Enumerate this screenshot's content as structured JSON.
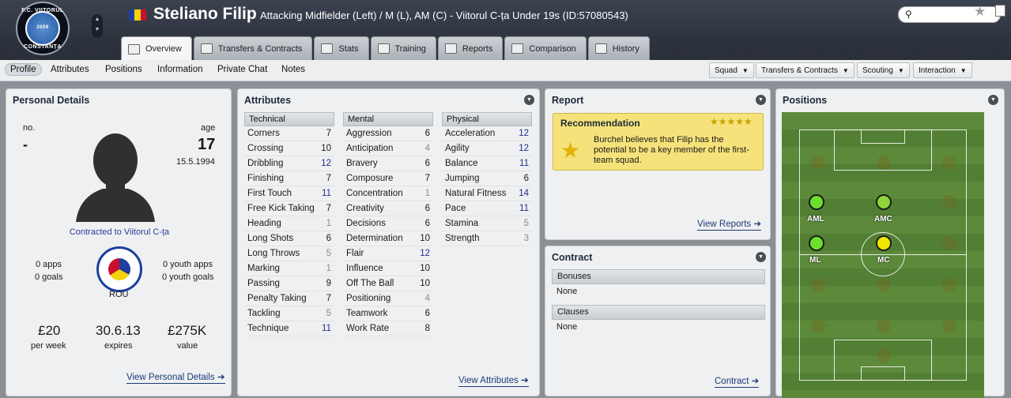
{
  "header": {
    "player_name": "Steliano Filip",
    "description": "Attacking Midfielder (Left) / M (L), AM (C) - Viitorul C-ța Under 19s (ID:57080543)",
    "club_badge_top": "F.C. VIITORUL",
    "club_badge_bottom": "CONSTANȚA",
    "club_badge_year": "2009"
  },
  "tabs": [
    {
      "label": "Overview"
    },
    {
      "label": "Transfers & Contracts"
    },
    {
      "label": "Stats"
    },
    {
      "label": "Training"
    },
    {
      "label": "Reports"
    },
    {
      "label": "Comparison"
    },
    {
      "label": "History"
    }
  ],
  "subnav": {
    "links": [
      "Profile",
      "Attributes",
      "Positions",
      "Information",
      "Private Chat",
      "Notes"
    ],
    "dropdowns": [
      "Squad",
      "Transfers & Contracts",
      "Scouting",
      "Interaction"
    ]
  },
  "personal": {
    "title": "Personal Details",
    "no_label": "no.",
    "no_value": "-",
    "age_label": "age",
    "age_value": "17",
    "dob": "15.5.1994",
    "contract": "Contracted to Viitorul C-ța",
    "apps": "0 apps",
    "goals": "0 goals",
    "youth_apps": "0 youth apps",
    "youth_goals": "0 youth goals",
    "nation": "ROU",
    "wage": "£20",
    "wage_label": "per week",
    "expires": "30.6.13",
    "expires_label": "expires",
    "value": "£275K",
    "value_label": "value",
    "link": "View Personal Details"
  },
  "attributes": {
    "title": "Attributes",
    "link": "View Attributes",
    "technical": {
      "label": "Technical",
      "rows": [
        [
          "Corners",
          "7"
        ],
        [
          "Crossing",
          "10"
        ],
        [
          "Dribbling",
          "12"
        ],
        [
          "Finishing",
          "7"
        ],
        [
          "First Touch",
          "11"
        ],
        [
          "Free Kick Taking",
          "7"
        ],
        [
          "Heading",
          "1"
        ],
        [
          "Long Shots",
          "6"
        ],
        [
          "Long Throws",
          "5"
        ],
        [
          "Marking",
          "1"
        ],
        [
          "Passing",
          "9"
        ],
        [
          "Penalty Taking",
          "7"
        ],
        [
          "Tackling",
          "5"
        ],
        [
          "Technique",
          "11"
        ]
      ]
    },
    "mental": {
      "label": "Mental",
      "rows": [
        [
          "Aggression",
          "6"
        ],
        [
          "Anticipation",
          "4"
        ],
        [
          "Bravery",
          "6"
        ],
        [
          "Composure",
          "7"
        ],
        [
          "Concentration",
          "1"
        ],
        [
          "Creativity",
          "6"
        ],
        [
          "Decisions",
          "6"
        ],
        [
          "Determination",
          "10"
        ],
        [
          "Flair",
          "12"
        ],
        [
          "Influence",
          "10"
        ],
        [
          "Off The Ball",
          "10"
        ],
        [
          "Positioning",
          "4"
        ],
        [
          "Teamwork",
          "6"
        ],
        [
          "Work Rate",
          "8"
        ]
      ]
    },
    "physical": {
      "label": "Physical",
      "rows": [
        [
          "Acceleration",
          "12"
        ],
        [
          "Agility",
          "12"
        ],
        [
          "Balance",
          "11"
        ],
        [
          "Jumping",
          "6"
        ],
        [
          "Natural Fitness",
          "14"
        ],
        [
          "Pace",
          "11"
        ],
        [
          "Stamina",
          "5"
        ],
        [
          "Strength",
          "3"
        ]
      ]
    }
  },
  "report": {
    "title": "Report",
    "rec_title": "Recommendation",
    "rec_text": "Burchel believes that Filip has the potential to be a key member of the first-team squad.",
    "stars": "★★★★★",
    "link": "View Reports"
  },
  "contract": {
    "title": "Contract",
    "bonuses_label": "Bonuses",
    "bonuses_value": "None",
    "clauses_label": "Clauses",
    "clauses_value": "None",
    "link": "Contract"
  },
  "positions": {
    "title": "Positions",
    "labels": {
      "aml": "AML",
      "amc": "AMC",
      "ml": "ML",
      "mc": "MC"
    }
  },
  "colors": {
    "high": "#1d2e8c",
    "mid": "#1a1a1a",
    "low": "#8a8a8a",
    "accent": "#2a3b9a"
  }
}
